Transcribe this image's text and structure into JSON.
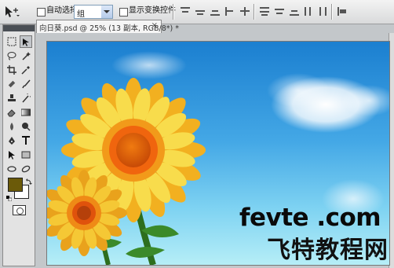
{
  "options_bar": {
    "tool_icon": "move-tool-icon",
    "auto_select_label": "自动选择:",
    "auto_select_value": "组",
    "show_transform_label": "显示变换控件"
  },
  "document": {
    "tab_title": "向日葵.psd @ 25% (13 副本, RGB/8*) *",
    "close_glyph": "×"
  },
  "tools": [
    "move-tool-icon",
    "marquee-tool-icon",
    "lasso-tool-icon",
    "magic-wand-icon",
    "crop-tool-icon",
    "eyedropper-icon",
    "healing-brush-icon",
    "brush-tool-icon",
    "clone-stamp-icon",
    "history-brush-icon",
    "eraser-tool-icon",
    "gradient-tool-icon",
    "blur-tool-icon",
    "dodge-tool-icon",
    "pen-tool-icon",
    "type-tool-icon",
    "path-selection-icon",
    "shape-tool-icon",
    "3d-rotate-icon",
    "3d-orbit-icon",
    "hand-tool-icon",
    "zoom-tool-icon"
  ],
  "colors": {
    "foreground": "#6b5a09",
    "background": "#ffffff"
  },
  "watermark": {
    "line1": "fevte .com",
    "line2": "飞特教程网"
  }
}
